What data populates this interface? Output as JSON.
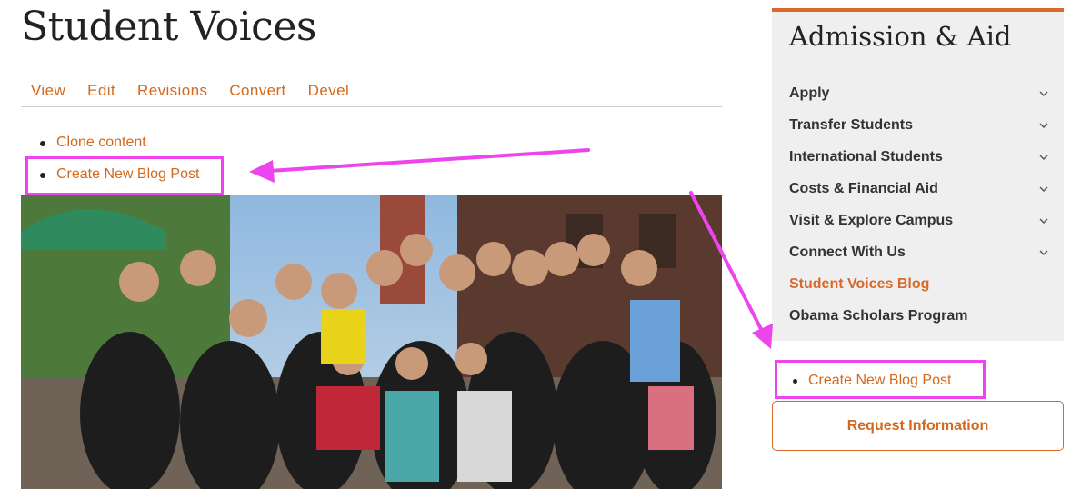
{
  "page": {
    "title": "Student Voices"
  },
  "tabs": [
    "View",
    "Edit",
    "Revisions",
    "Convert",
    "Devel"
  ],
  "actions": [
    "Clone content",
    "Create New Blog Post"
  ],
  "photo": {
    "icon": "group-photo-icon"
  },
  "sidebar": {
    "title": "Admission & Aid",
    "items": [
      {
        "label": "Apply",
        "expandable": true
      },
      {
        "label": "Transfer Students",
        "expandable": true
      },
      {
        "label": "International Students",
        "expandable": true
      },
      {
        "label": "Costs & Financial Aid",
        "expandable": true
      },
      {
        "label": "Visit & Explore Campus",
        "expandable": true
      },
      {
        "label": "Connect With Us",
        "expandable": true
      },
      {
        "label": "Student Voices Blog",
        "expandable": false,
        "active": true
      },
      {
        "label": "Obama Scholars Program",
        "expandable": false
      }
    ],
    "create_link": "Create New Blog Post",
    "request_button": "Request Information"
  },
  "colors": {
    "accent": "#d9692b",
    "link": "#d2691e",
    "highlight": "#ee44ee",
    "sidebar_bg": "#efefef"
  }
}
